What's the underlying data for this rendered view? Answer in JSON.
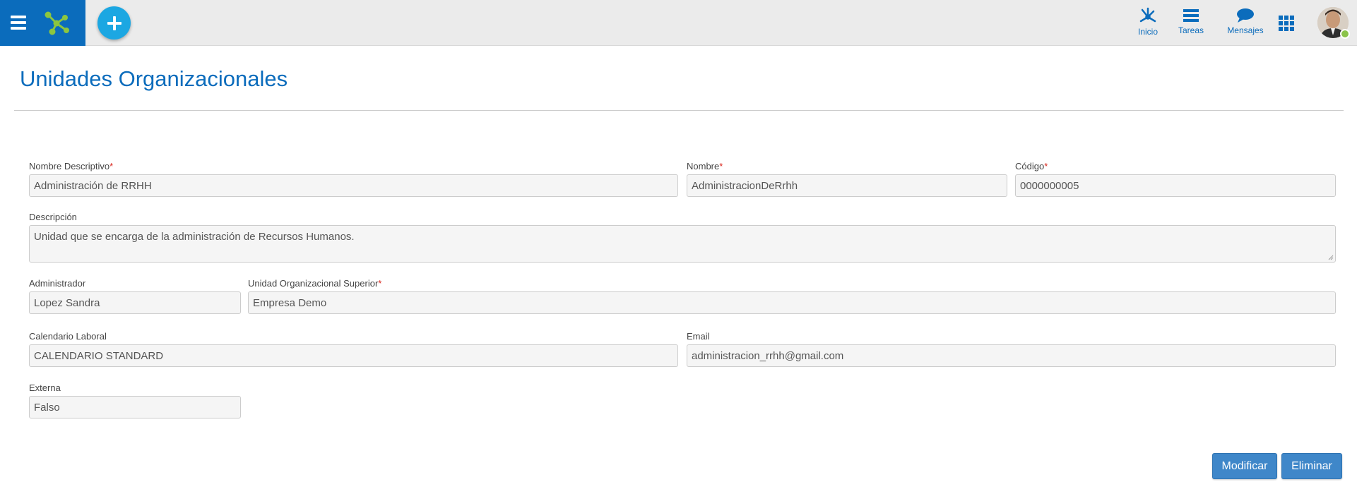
{
  "header": {
    "nav": [
      {
        "label": "Inicio",
        "icon": "network-icon"
      },
      {
        "label": "Tareas",
        "icon": "tasks-icon"
      },
      {
        "label": "Mensajes",
        "icon": "chat-bubble-icon"
      }
    ],
    "accent": "#0b6cbc",
    "add_button_color": "#1ca7e2",
    "status_color": "#8bc34a"
  },
  "page": {
    "title": "Unidades Organizacionales"
  },
  "form": {
    "nombre_descriptivo": {
      "label": "Nombre Descriptivo",
      "required": "*",
      "value": "Administración de RRHH"
    },
    "nombre": {
      "label": "Nombre",
      "required": "*",
      "value": "AdministracionDeRrhh"
    },
    "codigo": {
      "label": "Código",
      "required": "*",
      "value": "0000000005"
    },
    "descripcion": {
      "label": "Descripción",
      "value": "Unidad que se encarga de la administración de Recursos Humanos."
    },
    "administrador": {
      "label": "Administrador",
      "value": "Lopez Sandra"
    },
    "unidad_superior": {
      "label": "Unidad Organizacional Superior",
      "required": "*",
      "value": "Empresa Demo"
    },
    "calendario": {
      "label": "Calendario Laboral",
      "value": "CALENDARIO STANDARD"
    },
    "email": {
      "label": "Email",
      "value": "administracion_rrhh@gmail.com"
    },
    "externa": {
      "label": "Externa",
      "value": "Falso"
    }
  },
  "actions": {
    "modificar": "Modificar",
    "eliminar": "Eliminar"
  }
}
